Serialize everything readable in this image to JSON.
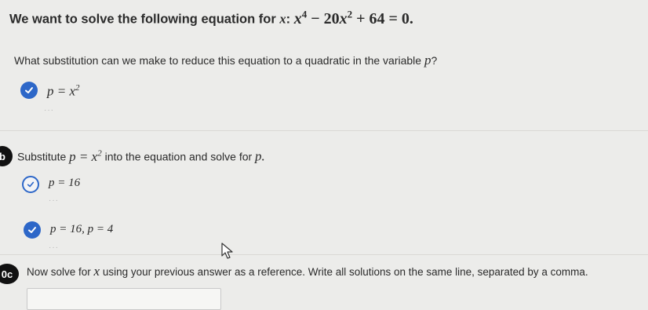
{
  "intro": {
    "text": "We want to solve the following equation for",
    "var": "x",
    "colon": ":",
    "eq_x": "x",
    "eq_exp1": "4",
    "eq_mid": " − 20",
    "eq_x2": "x",
    "eq_exp2": "2",
    "eq_end": " + 64 = 0."
  },
  "part_a": {
    "question": "What substitution can we make to reduce this equation to a quadratic in the variable",
    "var": "p",
    "qmark": "?",
    "answer": "p = x",
    "answer_exp": "2",
    "dots": "···"
  },
  "part_b": {
    "badge": "b",
    "question_pre": "Substitute",
    "sub_expr": "p = x",
    "sub_exp": "2",
    "question_post": "into the equation and solve for",
    "var": "p.",
    "attempt1": "p = 16",
    "attempt1_dots": "···",
    "attempt2": "p = 16,  p = 4",
    "attempt2_dots": "···"
  },
  "part_c": {
    "badge": "0c",
    "question_pre": "Now solve for",
    "var": "x",
    "question_post": "using your previous answer as a reference. Write all solutions on the same line, separated by a comma.",
    "input_value": ""
  },
  "colors": {
    "background": "#ececea",
    "check_blue": "#2d67c8",
    "badge_black": "#111111"
  }
}
